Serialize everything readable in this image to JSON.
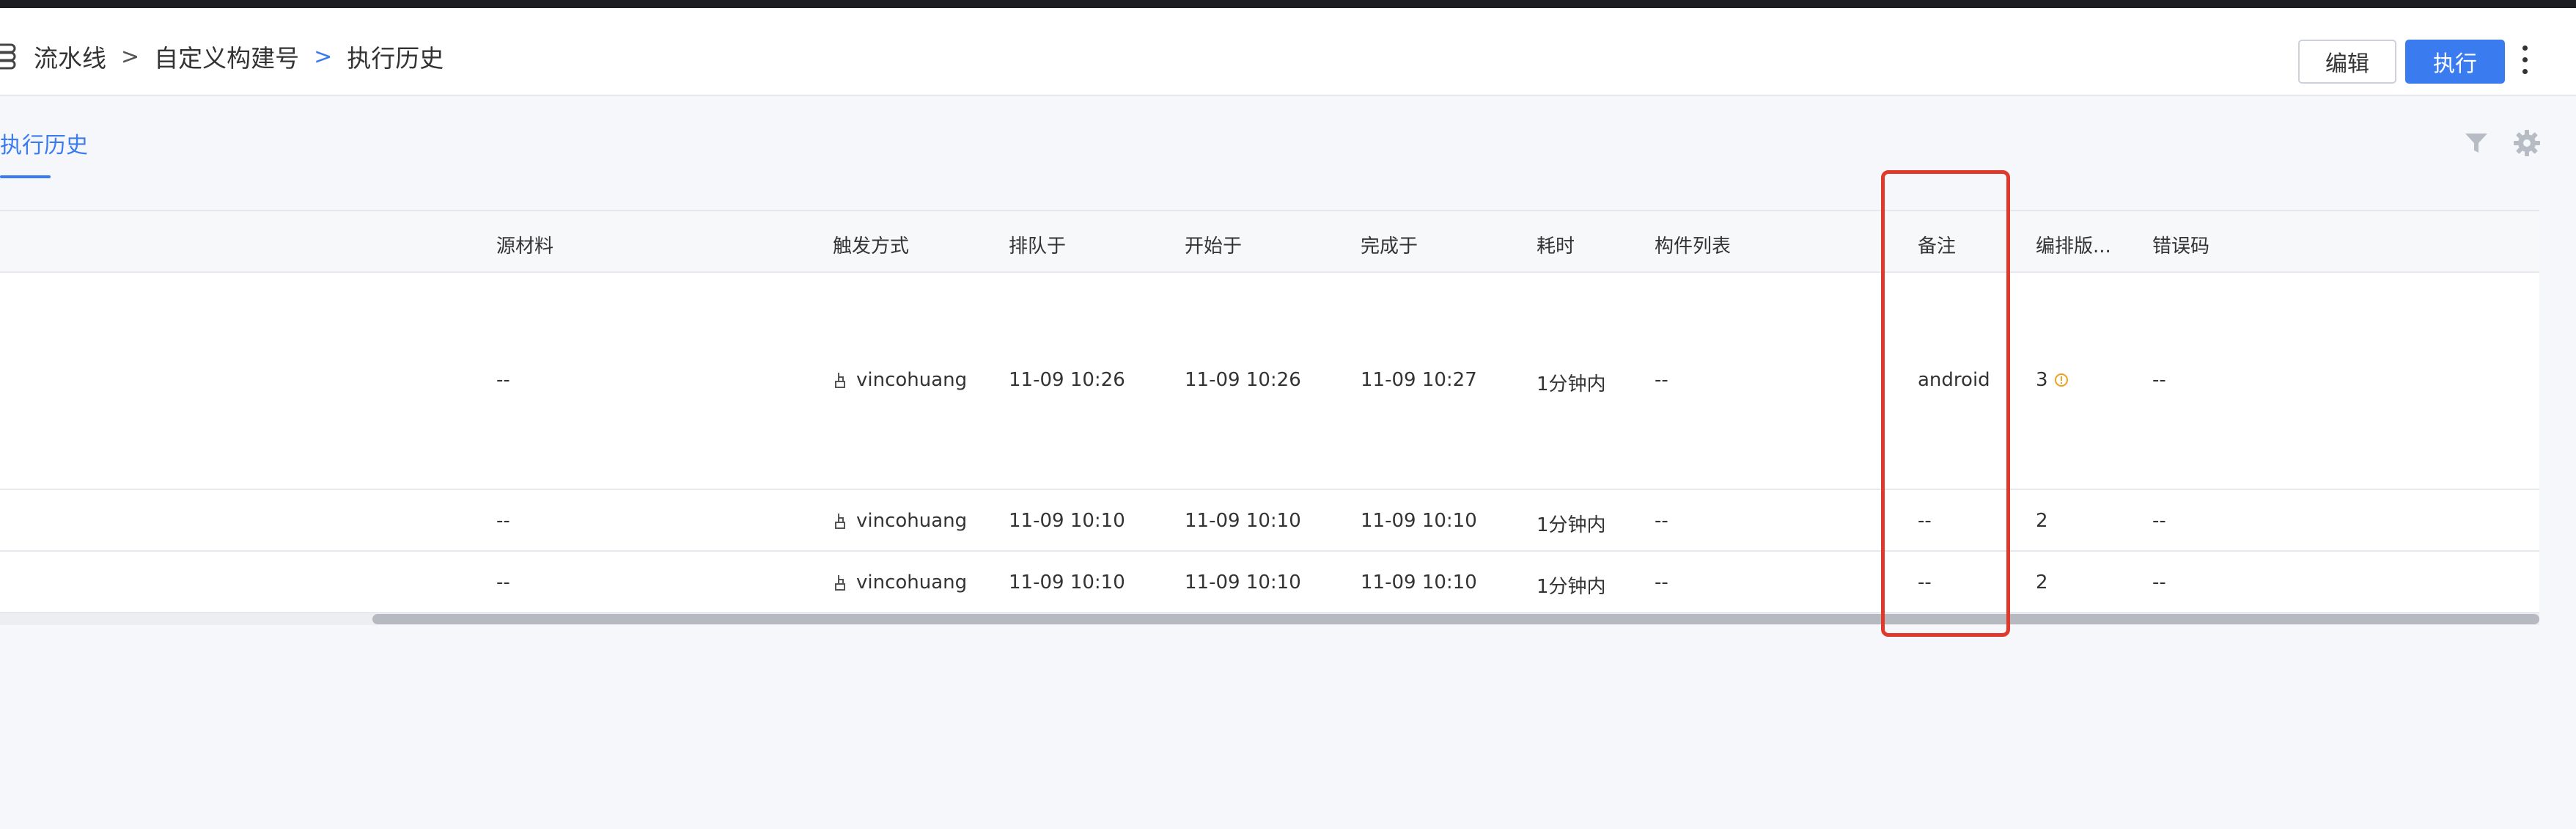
{
  "breadcrumb": {
    "items": [
      "流水线",
      "自定义构建号",
      "执行历史"
    ],
    "separator": ">"
  },
  "actions": {
    "edit_label": "编辑",
    "run_label": "执行"
  },
  "tabs": [
    {
      "label": "执行历史",
      "active": true
    }
  ],
  "toolbar_icons": [
    "filter-icon",
    "gear-icon"
  ],
  "table": {
    "columns": [
      "源材料",
      "触发方式",
      "排队于",
      "开始于",
      "完成于",
      "耗时",
      "构件列表",
      "备注",
      "编排版...",
      "错误码"
    ],
    "rows": [
      {
        "source": "--",
        "trigger": "vincohuang",
        "queued": "11-09 10:26",
        "started": "11-09 10:26",
        "finished": "11-09 10:27",
        "duration": "1分钟内",
        "artifacts": "--",
        "remark": "android",
        "version": "3",
        "version_warning": true,
        "error_code": "--"
      },
      {
        "source": "--",
        "trigger": "vincohuang",
        "queued": "11-09 10:10",
        "started": "11-09 10:10",
        "finished": "11-09 10:10",
        "duration": "1分钟内",
        "artifacts": "--",
        "remark": "--",
        "version": "2",
        "version_warning": false,
        "error_code": "--"
      },
      {
        "source": "--",
        "trigger": "vincohuang",
        "queued": "11-09 10:10",
        "started": "11-09 10:10",
        "finished": "11-09 10:10",
        "duration": "1分钟内",
        "artifacts": "--",
        "remark": "--",
        "version": "2",
        "version_warning": false,
        "error_code": "--"
      }
    ]
  },
  "colors": {
    "accent": "#3a7bf0",
    "highlight_box": "#e0392b",
    "warning": "#f0a020"
  }
}
